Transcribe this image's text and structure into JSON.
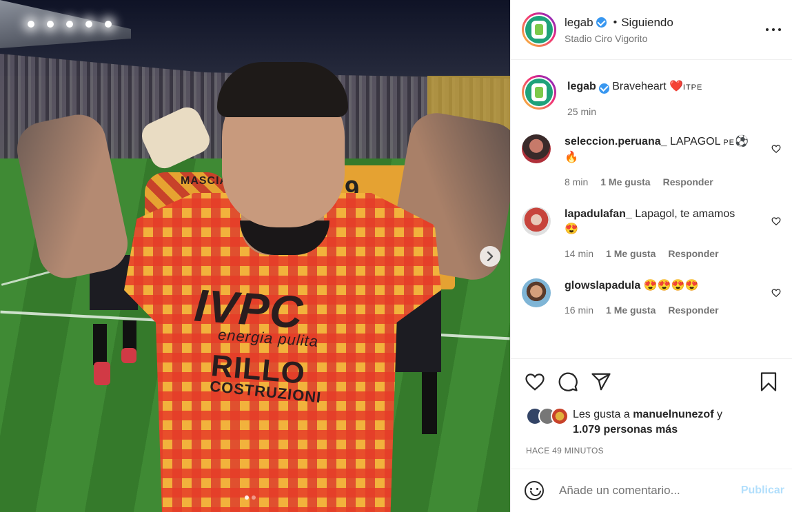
{
  "post": {
    "media": {
      "image_alt": "Jugador del Benevento celebrando en el estadio",
      "sponsor_main": "IVPC",
      "sponsor_sub": "energia pulita",
      "sponsor_second": "RILLO",
      "sponsor_second_sub": "COSTRUZIONI",
      "bg_name": "MASCIANG",
      "bg_number": "93",
      "bg_number2": "9",
      "carousel_slides": 2,
      "carousel_active": 1
    },
    "header": {
      "username": "legab",
      "verified": true,
      "separator": "•",
      "follow_status": "Siguiendo",
      "location": "Stadio Ciro Vigorito"
    },
    "caption": {
      "username": "legab",
      "text": "Braveheart",
      "heart": "❤️",
      "tag": "ITPE",
      "time": "25 min"
    },
    "comments": [
      {
        "username": "seleccion.peruana_",
        "text": "LAPAGOL",
        "suffix": "PE",
        "emoji_line1": "⚽",
        "emoji_line2": "🔥",
        "time": "8 min",
        "likes": "1 Me gusta",
        "reply": "Responder",
        "avatar_color": "#5a3a3a"
      },
      {
        "username": "lapadulafan_",
        "text": "Lapagol, te amamos",
        "emoji_line2": "😍",
        "time": "14 min",
        "likes": "1 Me gusta",
        "reply": "Responder",
        "avatar_color": "#c7443c"
      },
      {
        "username": "glowslapadula",
        "text": "😍😍😍😍",
        "time": "16 min",
        "likes": "1 Me gusta",
        "reply": "Responder",
        "avatar_color": "#8a6a4f"
      }
    ],
    "likes": {
      "prefix": "Les gusta a",
      "user": "manuelnunezof",
      "connector": "y",
      "others": "1.079 personas más",
      "avatar_colors": [
        "#334466",
        "#777777",
        "#e2b23c"
      ]
    },
    "posted": "HACE 49 MINUTOS",
    "composer": {
      "placeholder": "Añade un comentario...",
      "publish": "Publicar"
    }
  },
  "colors": {
    "accent": "#0095f6",
    "publish_disabled": "#b2dffc",
    "verified": "#3897f0",
    "muted": "#737373",
    "text": "#262626",
    "border": "#efefef"
  }
}
